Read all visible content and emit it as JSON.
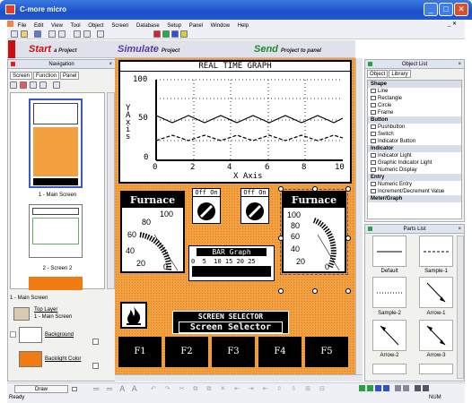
{
  "window": {
    "title": "C-more micro",
    "min_glyph": "_",
    "max_glyph": "□",
    "close_glyph": "✕"
  },
  "menu": [
    "File",
    "Edit",
    "View",
    "Tool",
    "Object",
    "Screen",
    "Database",
    "Setup",
    "Panel",
    "Window",
    "Help"
  ],
  "menu_right": "_ ✕",
  "actions": {
    "start_big": "Start",
    "start_small": "a Project",
    "simulate_big": "Simulate",
    "simulate_small": "Project",
    "send_big": "Send",
    "send_small": "Project to panel"
  },
  "navigation": {
    "title": "Navigation",
    "close": "×",
    "tabs": [
      "Screen",
      "Function",
      "Panel"
    ],
    "screens": [
      "1 - Main Screen",
      "2 - Screen 2"
    ],
    "selected_label": "1 - Main Screen",
    "layers": [
      {
        "label": "Top Layer",
        "sub": "1 - Main Screen"
      },
      {
        "label": "Background",
        "sub": ""
      },
      {
        "label": "Backlight Color",
        "sub": ""
      }
    ]
  },
  "canvas": {
    "graph": {
      "title": "REAL TIME GRAPH",
      "y_axis_label": "Y Axis",
      "x_axis_label": "X Axis",
      "y_ticks": [
        "100",
        "50",
        "0"
      ],
      "x_ticks": [
        "0",
        "2",
        "4",
        "6",
        "8",
        "10"
      ]
    },
    "furnace1": {
      "title": "Furnace #1",
      "ticks": [
        "100",
        "80",
        "60",
        "40",
        "20",
        "0"
      ]
    },
    "furnace2": {
      "title": "Furnace #2",
      "ticks": [
        "100",
        "80",
        "60",
        "40",
        "20",
        "0"
      ]
    },
    "switch_label": "Off On",
    "bar_graph": {
      "title": "BAR Graph",
      "ticks": "0  5  10 15 20 25"
    },
    "screen_selector": {
      "title": "SCREEN SELECTOR",
      "button": "Screen Selector"
    },
    "fkeys": [
      "F1",
      "F2",
      "F3",
      "F4",
      "F5"
    ]
  },
  "object_list": {
    "title": "Object List",
    "tabs": [
      "Object",
      "Library"
    ],
    "rows": [
      {
        "t": "Shape",
        "cat": true
      },
      {
        "t": "Line"
      },
      {
        "t": "Rectangle"
      },
      {
        "t": "Circle"
      },
      {
        "t": "Frame"
      },
      {
        "t": "Button",
        "cat": true
      },
      {
        "t": "Pushbutton"
      },
      {
        "t": "Switch"
      },
      {
        "t": "Indicator Button"
      },
      {
        "t": "Indicator",
        "cat": true
      },
      {
        "t": "Indicator Light"
      },
      {
        "t": "Graphic Indicator Light"
      },
      {
        "t": "Numeric Display"
      },
      {
        "t": "Entry",
        "cat": true
      },
      {
        "t": "Numeric Entry"
      },
      {
        "t": "Increment/Decrement Value"
      },
      {
        "t": "Meter/Graph",
        "cat": true
      }
    ]
  },
  "parts_list": {
    "title": "Parts List",
    "items": [
      "Default",
      "Sample-1",
      "Sample-2",
      "Arrow-1",
      "Arrow-2",
      "Arrow-3"
    ]
  },
  "bottom": {
    "draw": "Draw"
  },
  "status": {
    "left": "Ready",
    "right": "NUM"
  },
  "colors": {
    "title_blue": "#1c50c8",
    "canvas_orange": "#f2a040",
    "start_red": "#cc1010",
    "simulate_purple": "#5a3aa8",
    "send_green": "#1c8a30"
  }
}
